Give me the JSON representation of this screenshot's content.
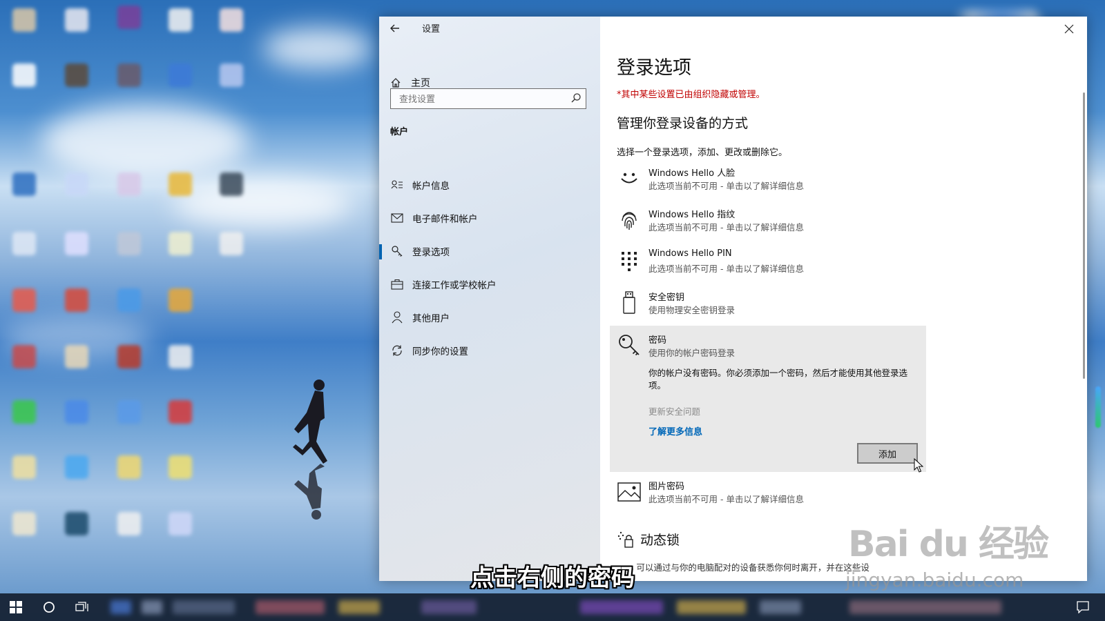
{
  "window": {
    "title": "设置",
    "nav": {
      "home_label": "主页",
      "search_placeholder": "查找设置",
      "section_label": "帐户",
      "items": [
        {
          "label": "帐户信息",
          "icon": "account-info-icon"
        },
        {
          "label": "电子邮件和帐户",
          "icon": "mail-icon"
        },
        {
          "label": "登录选项",
          "icon": "key-icon",
          "active": true
        },
        {
          "label": "连接工作或学校帐户",
          "icon": "briefcase-icon"
        },
        {
          "label": "其他用户",
          "icon": "person-icon"
        },
        {
          "label": "同步你的设置",
          "icon": "sync-icon"
        }
      ]
    },
    "content": {
      "page_title": "登录选项",
      "org_note": "*其中某些设置已由组织隐藏或管理。",
      "sub_heading": "管理你登录设备的方式",
      "intro": "选择一个登录选项，添加、更改或删除它。",
      "options": [
        {
          "title": "Windows Hello 人脸",
          "desc": "此选项当前不可用 - 单击以了解详细信息",
          "icon": "face-icon"
        },
        {
          "title": "Windows Hello 指纹",
          "desc": "此选项当前不可用 - 单击以了解详细信息",
          "icon": "fingerprint-icon"
        },
        {
          "title": "Windows Hello PIN",
          "desc": "此选项当前不可用 - 单击以了解详细信息",
          "icon": "pin-keypad-icon"
        },
        {
          "title": "安全密钥",
          "desc": "使用物理安全密钥登录",
          "icon": "usb-key-icon"
        }
      ],
      "password": {
        "title": "密码",
        "desc": "使用你的帐户密码登录",
        "message": "你的帐户没有密码。你必须添加一个密码，然后才能使用其他登录选项。",
        "security_question": "更新安全问题",
        "learn_more": "了解更多信息",
        "add_button": "添加",
        "icon": "key-icon"
      },
      "picture_password": {
        "title": "图片密码",
        "desc": "此选项当前不可用 - 单击以了解详细信息",
        "icon": "picture-icon"
      },
      "dynamic_lock": {
        "title": "动态锁",
        "desc": "ows 可以通过与你的电脑配对的设备获悉你何时离开，并在这些设",
        "icon": "dynamic-lock-icon"
      }
    }
  },
  "overlay": {
    "subtitle": "点击右侧的密码",
    "watermark_main": "Bai du 经验",
    "watermark_url": "jingyan.baidu.com"
  },
  "colors": {
    "accent": "#0063b1",
    "link": "#0067b8",
    "warning": "#c00000",
    "taskbar": "#16223a"
  }
}
